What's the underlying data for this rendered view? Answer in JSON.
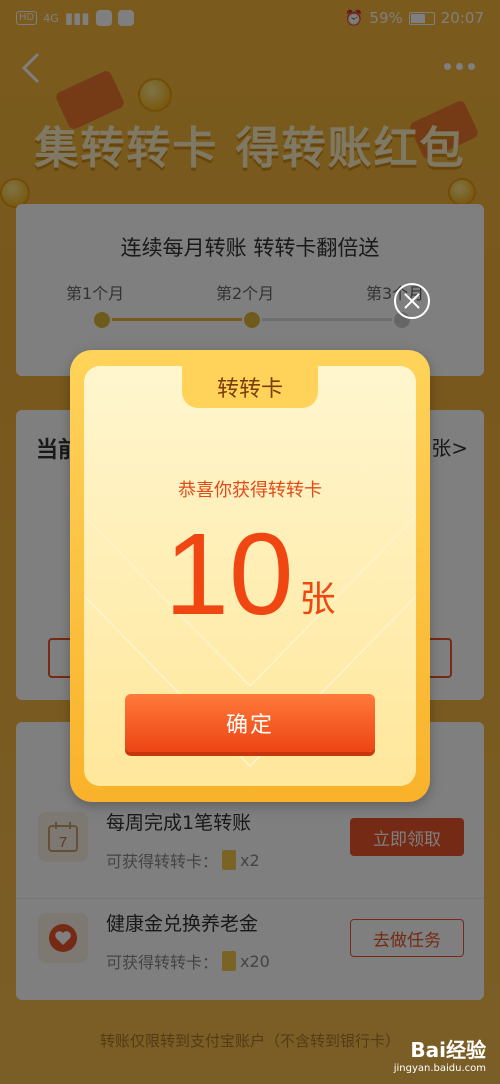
{
  "status_bar": {
    "network": "HD",
    "signal": "4G",
    "battery": "59%",
    "time": "20:07"
  },
  "hero": {
    "title": "集转转卡  得转账红包"
  },
  "progress_card": {
    "title": "连续每月转账   转转卡翻倍送",
    "steps": [
      "第1个月",
      "第2个月",
      "第3个月"
    ]
  },
  "cards_section": {
    "left_label": "当前",
    "right_label": "张>"
  },
  "tasks": [
    {
      "title": "每周完成1笔转账",
      "reward_label": "可获得转转卡：",
      "reward_count": "x2",
      "button": "立即领取",
      "icon_text": "7"
    },
    {
      "title": "健康金兑换养老金",
      "reward_label": "可获得转转卡：",
      "reward_count": "x20",
      "button": "去做任务"
    }
  ],
  "footnote": "转账仅限转到支付宝账户（不含转到银行卡）",
  "watermark": {
    "brand": "Bai经验",
    "url": "jingyan.baidu.com"
  },
  "modal": {
    "tab": "转转卡",
    "subtitle": "恭喜你获得转转卡",
    "amount": "10",
    "unit": "张",
    "confirm": "确定"
  },
  "colors": {
    "accent": "#f04612",
    "button": "#ec4414",
    "modal_frame": "#f9b22a"
  }
}
